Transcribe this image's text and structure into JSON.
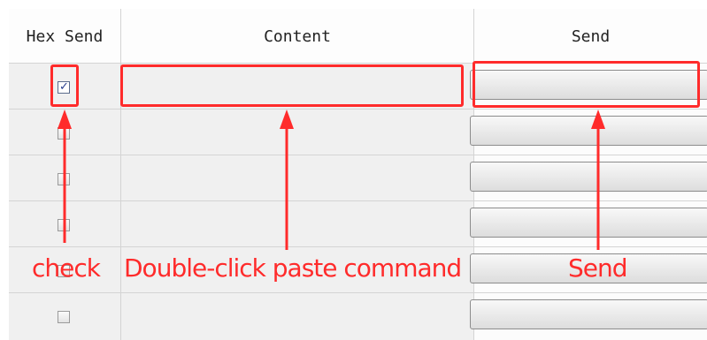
{
  "columns": {
    "hex_send": "Hex Send",
    "content": "Content",
    "send": "Send"
  },
  "rows": [
    {
      "hex_checked": true,
      "content": ""
    },
    {
      "hex_checked": false,
      "content": ""
    },
    {
      "hex_checked": false,
      "content": ""
    },
    {
      "hex_checked": false,
      "content": ""
    },
    {
      "hex_checked": false,
      "content": ""
    },
    {
      "hex_checked": false,
      "content": ""
    }
  ],
  "annotations": {
    "check": "check",
    "content": "Double-click paste command",
    "send": "Send"
  },
  "colors": {
    "annotation": "#ff2b2b",
    "grid_line": "#d4d4d4",
    "cell_background": "#f0f0f0"
  }
}
